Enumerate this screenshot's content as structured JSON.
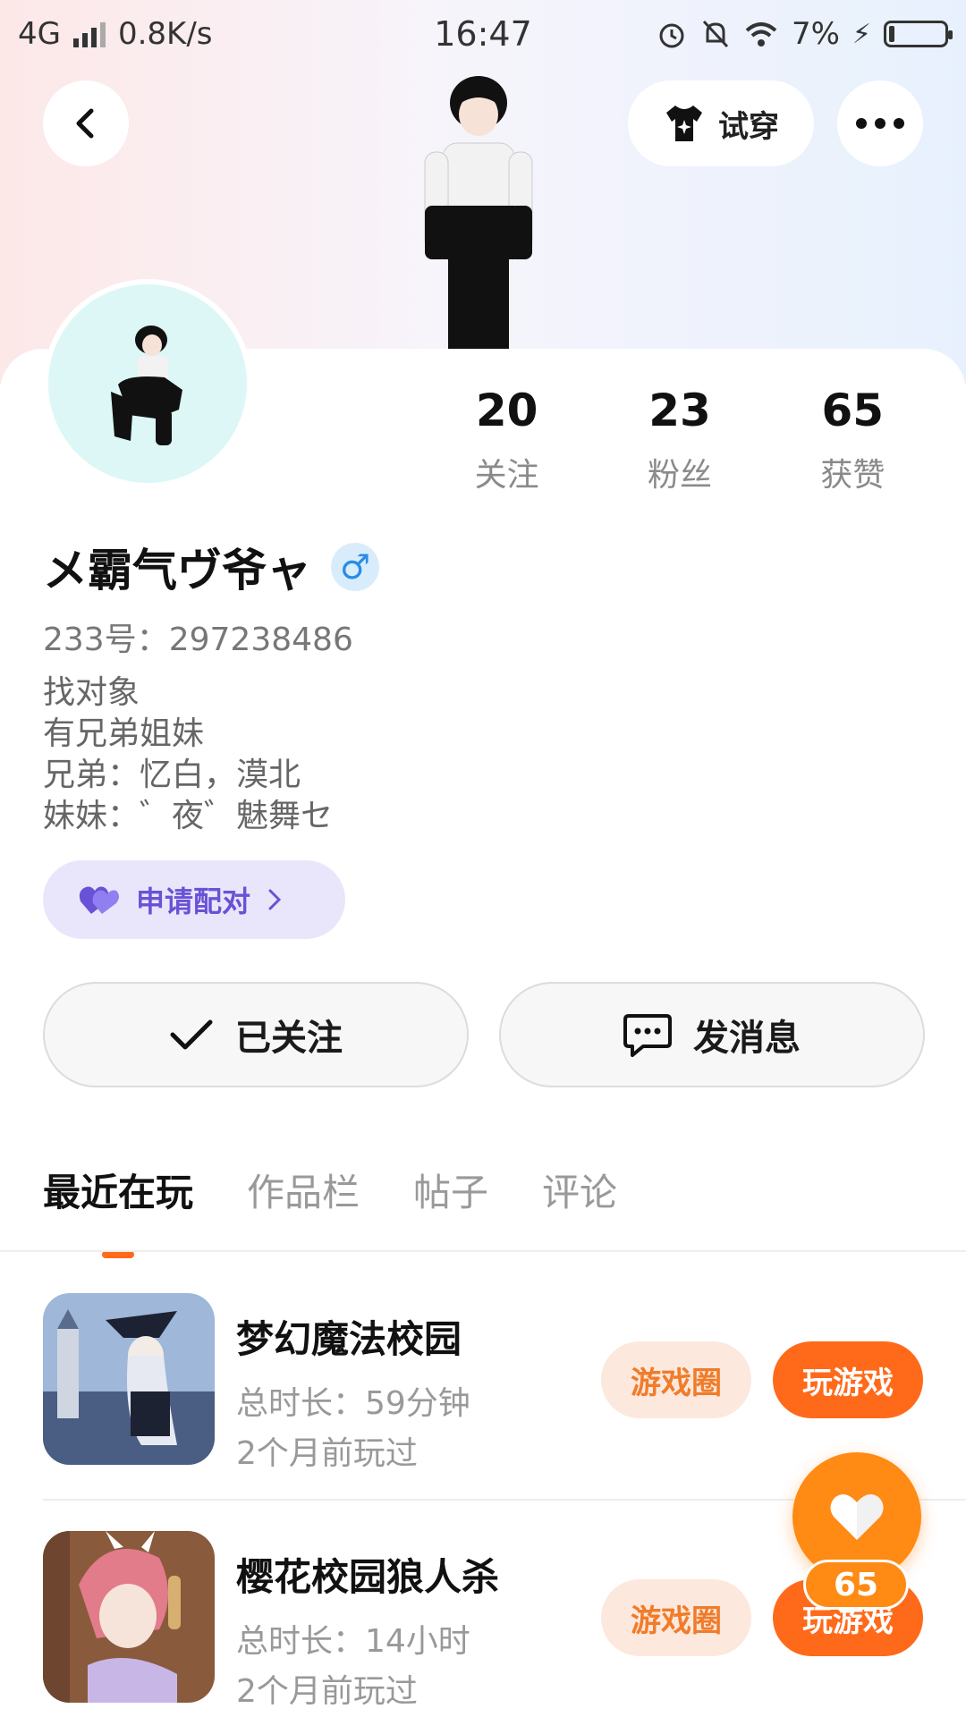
{
  "status_bar": {
    "network": "4G",
    "speed": "0.8K/s",
    "time": "16:47",
    "battery": "7%"
  },
  "header": {
    "tryon_label": "试穿",
    "back_icon": "chevron-left-icon",
    "more_icon": "more-dots-icon",
    "tryon_icon": "tshirt-icon"
  },
  "stats": [
    {
      "value": "20",
      "label": "关注"
    },
    {
      "value": "23",
      "label": "粉丝"
    },
    {
      "value": "65",
      "label": "获赞"
    }
  ],
  "profile": {
    "nickname": "メ霸气ヴ爷ャ",
    "gender_symbol": "♂",
    "uid": "233号：297238486",
    "bio_lines": [
      "找对象",
      "有兄弟姐妹",
      "兄弟：忆白，漠北",
      "妹妹：゛夜゛魅舞セ"
    ]
  },
  "pair": {
    "label": "申请配对",
    "color": "#6a52d6"
  },
  "actions": {
    "follow_label": "已关注",
    "message_label": "发消息"
  },
  "tabs": [
    {
      "label": "最近在玩",
      "active": true
    },
    {
      "label": "作品栏",
      "active": false
    },
    {
      "label": "帖子",
      "active": false
    },
    {
      "label": "评论",
      "active": false
    }
  ],
  "games": [
    {
      "title": "梦幻魔法校园",
      "duration": "总时长：59分钟",
      "last_played": "2个月前玩过",
      "circle_label": "游戏圈",
      "play_label": "玩游戏"
    },
    {
      "title": "樱花校园狼人杀",
      "duration": "总时长：14小时",
      "last_played": "2个月前玩过",
      "circle_label": "游戏圈",
      "play_label": "玩游戏"
    }
  ],
  "like_float": {
    "count": "65"
  },
  "colors": {
    "accent": "#ff6a1a",
    "like": "#ff8a14",
    "gender": "#2a8de5"
  }
}
